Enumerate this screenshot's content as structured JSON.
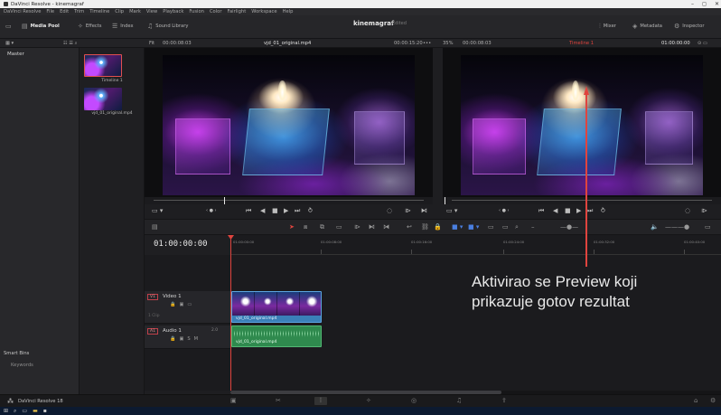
{
  "window": {
    "title": "DaVinci Resolve - kinemagraf",
    "controls": [
      "–",
      "◻",
      "✕"
    ]
  },
  "menu": [
    "DaVinci Resolve",
    "File",
    "Edit",
    "Trim",
    "Timeline",
    "Clip",
    "Mark",
    "View",
    "Playback",
    "Fusion",
    "Color",
    "Fairlight",
    "Workspace",
    "Help"
  ],
  "toolbar": {
    "media_pool": "Media Pool",
    "effects": "Effects",
    "index": "Index",
    "sound_library": "Sound Library",
    "project_name": "kinemagraf",
    "project_status": "Edited",
    "mixer": "Mixer",
    "metadata": "Metadata",
    "inspector": "Inspector"
  },
  "source_header": {
    "zoom": "Fit",
    "timecode_left": "00:00:08:03",
    "clip_name": "vjd_01_original.mp4",
    "timecode_right": "00:00:15:20"
  },
  "program_header": {
    "zoom": "35%",
    "timecode_left": "00:00:08:03",
    "timeline_name": "Timeline 1",
    "timecode_right": "01:00:00:00"
  },
  "sidebar": {
    "master": "Master",
    "smart_bins": "Smart Bins",
    "keywords": "Keywords"
  },
  "media_pool": {
    "items": [
      {
        "label": "Timeline 1"
      },
      {
        "label": "vjd_01_original.mp4"
      }
    ]
  },
  "timeline": {
    "timecode": "01:00:00:00",
    "ruler": [
      "01:00:00:00",
      "01:00:08:00",
      "01:00:16:00",
      "01:00:24:00",
      "01:00:32:00",
      "01:00:40:00"
    ],
    "video_track": {
      "badge": "V1",
      "name": "Video 1",
      "sub": "1 Clip",
      "clip": "vjd_01_original.mp4"
    },
    "audio_track": {
      "badge": "A1",
      "name": "Audio 1",
      "vol": "2.0",
      "clip": "vjd_01_original.mp4"
    }
  },
  "annotation": {
    "line1": "Aktivirao se Preview koji",
    "line2": "prikazuje gotov rezultat"
  },
  "pagebar": {
    "brand": "DaVinci Resolve 18"
  },
  "colors": {
    "accent_red": "#e0443e",
    "video_clip": "#3a7fb8",
    "audio_clip": "#2f8a4e"
  }
}
